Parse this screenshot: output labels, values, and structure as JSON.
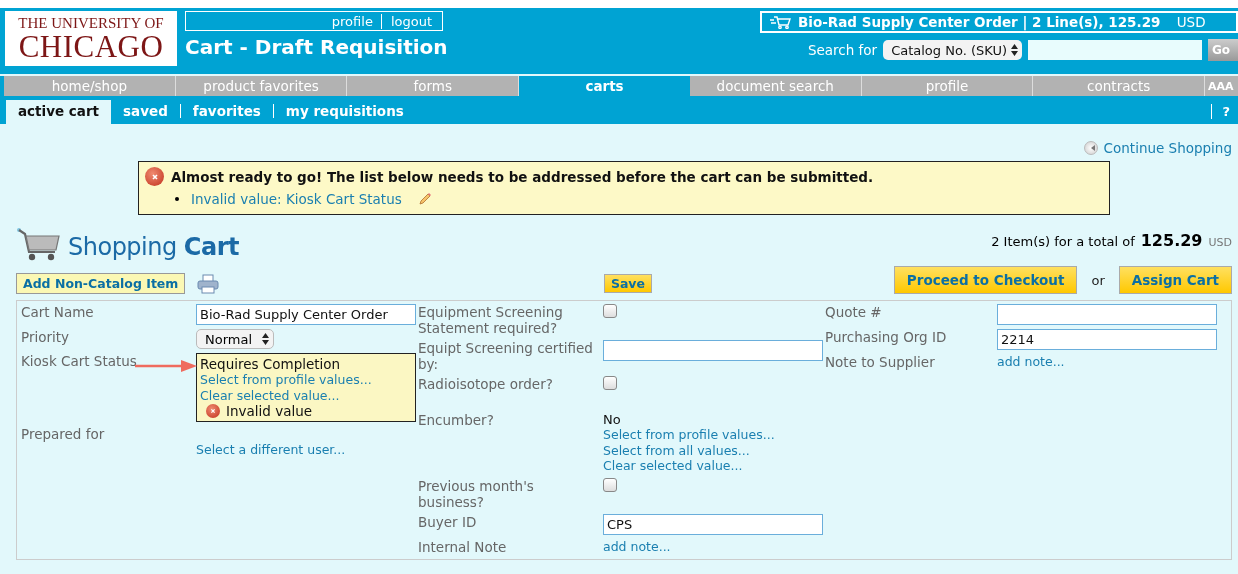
{
  "logo": {
    "line1": "THE UNIVERSITY OF",
    "line2": "CHICAGO"
  },
  "user_links": [
    {
      "label": "profile"
    },
    {
      "label": "logout"
    }
  ],
  "page_title": "Cart - Draft Requisition",
  "cart_summary": {
    "name": "Bio-Rad Supply Center Order | 2 Line(s), 125.29",
    "currency": "USD"
  },
  "search": {
    "label": "Search for",
    "scope": "Catalog No. (SKU)",
    "button": "Go"
  },
  "nav_tabs": [
    {
      "label": "home/shop",
      "selected": false
    },
    {
      "label": "product favorites",
      "selected": false
    },
    {
      "label": "forms",
      "selected": false
    },
    {
      "label": "carts",
      "selected": true
    },
    {
      "label": "document search",
      "selected": false
    },
    {
      "label": "profile",
      "selected": false
    },
    {
      "label": "contracts",
      "selected": false
    }
  ],
  "text_size": "AAA",
  "sub_tabs": [
    {
      "label": "active cart",
      "selected": true
    },
    {
      "label": "saved",
      "selected": false
    },
    {
      "label": "favorites",
      "selected": false
    },
    {
      "label": "my requisitions",
      "selected": false
    }
  ],
  "help": "?",
  "continue_shopping": "Continue Shopping",
  "alert": {
    "message": "Almost ready to go! The list below needs to be addressed before the cart can be submitted.",
    "items": [
      "Invalid value: Kiosk Cart Status"
    ]
  },
  "heading": "Shopping **Cart**",
  "totals": {
    "items": "2 Item(s)  for a total of",
    "amount": "125.29",
    "currency": "USD"
  },
  "buttons": {
    "add_item": "Add Non-Catalog Item",
    "save": "Save",
    "checkout": "Proceed to Checkout",
    "or": "or",
    "assign": "Assign Cart"
  },
  "form_columns": [
    [
      {
        "label": "Cart Name",
        "kind": "input",
        "value": "Bio-Rad Supply Center Order"
      },
      {
        "label": "Priority",
        "kind": "select",
        "value": "Normal"
      },
      {
        "label": "Kiosk Cart Status",
        "kind": "status",
        "value": "Requires Completion",
        "links": [
          "Select from profile values...",
          "Clear selected value..."
        ],
        "error": "Invalid value"
      },
      {
        "label": "Prepared for",
        "kind": "links",
        "links": [
          "Select a different user..."
        ]
      }
    ],
    [
      {
        "label": "Equipment Screening Statement required?",
        "kind": "checkbox",
        "checked": false
      },
      {
        "label": "Equipt Screening certified by:",
        "kind": "input"
      },
      {
        "label": "Radioisotope order?",
        "kind": "checkbox",
        "checked": false
      },
      {
        "label": "Encumber?",
        "kind": "lookup",
        "value": "No",
        "links": [
          "Select from profile values...",
          "Select from all values...",
          "Clear selected value..."
        ]
      },
      {
        "label": "Previous month's business?",
        "kind": "checkbox",
        "checked": false
      },
      {
        "label": "Buyer ID",
        "kind": "input",
        "value": "CPS"
      },
      {
        "label": "Internal Note",
        "kind": "links",
        "links": [
          "add note..."
        ]
      }
    ],
    [
      {
        "label": "Quote #",
        "kind": "input"
      },
      {
        "label": "Purchasing Org ID",
        "kind": "input",
        "value": "2214"
      },
      {
        "label": "Note to Supplier",
        "kind": "links",
        "links": [
          "add note..."
        ]
      }
    ]
  ]
}
